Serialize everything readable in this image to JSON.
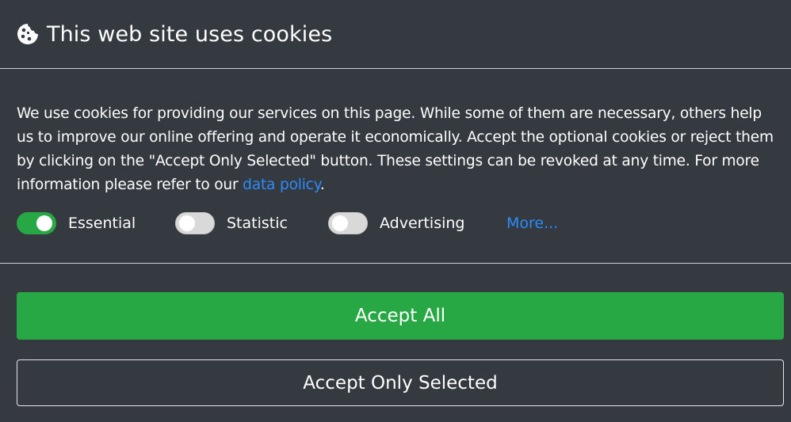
{
  "header": {
    "icon": "cookie-icon",
    "title": "This web site uses cookies"
  },
  "body": {
    "text_before_link": "We use cookies for providing our services on this page. While some of them are necessary, others help us to improve our online offering and operate it economically. Accept the optional cookies or reject them by clicking on the \"Accept Only Selected\" button. These settings can be revoked at any time. For more information please refer to our ",
    "link_text": "data policy",
    "text_after_link": "."
  },
  "switches": [
    {
      "label": "Essential",
      "checked": true
    },
    {
      "label": "Statistic",
      "checked": false
    },
    {
      "label": "Advertising",
      "checked": false
    }
  ],
  "more_link": "More...",
  "buttons": {
    "accept_all": "Accept All",
    "accept_selected": "Accept Only Selected"
  },
  "colors": {
    "background": "#343a40",
    "accent_green": "#28a745",
    "link_blue": "#2a8cff",
    "toggle_off": "#d9d9d9"
  }
}
